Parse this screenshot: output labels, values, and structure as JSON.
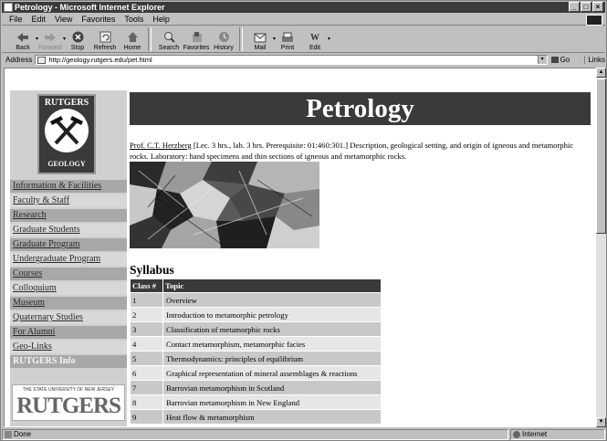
{
  "window": {
    "title": "Petrology - Microsoft Internet Explorer",
    "controls": [
      "_",
      "□",
      "×"
    ]
  },
  "menu": [
    "File",
    "Edit",
    "View",
    "Favorites",
    "Tools",
    "Help"
  ],
  "toolbar": [
    {
      "label": "Back",
      "icon": "back-arrow-icon",
      "disabled": false
    },
    {
      "label": "Forward",
      "icon": "forward-arrow-icon",
      "disabled": true
    },
    {
      "label": "Stop",
      "icon": "stop-icon",
      "disabled": false
    },
    {
      "label": "Refresh",
      "icon": "refresh-icon",
      "disabled": false
    },
    {
      "label": "Home",
      "icon": "home-icon",
      "disabled": false
    },
    {
      "label": "Search",
      "icon": "search-icon",
      "disabled": false
    },
    {
      "label": "Favorites",
      "icon": "favorites-icon",
      "disabled": false
    },
    {
      "label": "History",
      "icon": "history-icon",
      "disabled": false
    },
    {
      "label": "Mail",
      "icon": "mail-icon",
      "disabled": false
    },
    {
      "label": "Print",
      "icon": "print-icon",
      "disabled": false
    },
    {
      "label": "Edit",
      "icon": "edit-icon",
      "disabled": false
    }
  ],
  "address": {
    "label": "Address",
    "url": "http://geology.rutgers.edu/pet.html",
    "go": "Go",
    "links": "Links"
  },
  "status": {
    "left": "Done",
    "zone": "Internet"
  },
  "page": {
    "logo": {
      "top": "RUTGERS",
      "bottom": "GEOLOGY"
    },
    "nav": [
      "Information & Facilities",
      "Faculty & Staff",
      "Research",
      "Graduate Students",
      "Graduate Program",
      "Undergraduate Program",
      "Courses",
      "Colloquium",
      "Museum",
      "Quaternary Studies",
      "For Alumni",
      "Geo-Links",
      "RUTGERS Info"
    ],
    "rutgers_logo": {
      "tagline": "THE STATE UNIVERSITY OF NEW JERSEY",
      "name": "RUTGERS"
    },
    "title": "Petrology",
    "professor": "Prof. C.T. Herzberg",
    "description": " [Lec. 3 hrs., lab. 3 hrs. Prerequisite: 01:460:301.] Description, geological setting, and origin of igneous and metamorphic rocks. Laboratory: hand specimens and thin sections of igneous and metamorphic rocks.",
    "syllabus_heading": "Syllabus",
    "table": {
      "headers": [
        "Class #",
        "Topic"
      ],
      "rows": [
        [
          "1",
          "Overview"
        ],
        [
          "2",
          "Introduction to metamorphic petrology"
        ],
        [
          "3",
          "Classification of metamorphic rocks"
        ],
        [
          "4",
          "Contact metamorphism, metamorphic facies"
        ],
        [
          "5",
          "Thermodynamics: principles of equilibrium"
        ],
        [
          "6",
          "Graphical representation of mineral assemblages & reactions"
        ],
        [
          "7",
          "Barrovian metamorphism in Scotland"
        ],
        [
          "8",
          "Barrovian metamorphism in New England"
        ],
        [
          "9",
          "Heat flow & metamorphism"
        ]
      ]
    }
  }
}
